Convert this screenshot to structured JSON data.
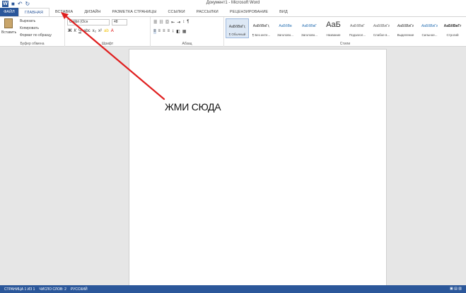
{
  "window": {
    "title": "Документ1 - Microsoft Word"
  },
  "tabs": [
    {
      "label": "ФАЙЛ"
    },
    {
      "label": "ГЛАВНАЯ"
    },
    {
      "label": "ВСТАВКА"
    },
    {
      "label": "ДИЗАЙН"
    },
    {
      "label": "РАЗМЕТКА СТРАНИЦЫ"
    },
    {
      "label": "ССЫЛКИ"
    },
    {
      "label": "РАССЫЛКИ"
    },
    {
      "label": "РЕЦЕНЗИРОВАНИЕ"
    },
    {
      "label": "ВИД"
    }
  ],
  "clipboard": {
    "paste": "Вставить",
    "cut": "Вырезать",
    "copy": "Копировать",
    "format_painter": "Формат по образцу",
    "label": "Буфер обмена"
  },
  "font": {
    "name": "Calibri (Осн",
    "size": "48",
    "label": "Шрифт"
  },
  "paragraph": {
    "label": "Абзац"
  },
  "styles": {
    "label": "Стили",
    "items": [
      {
        "preview": "АаБбВвГг,",
        "name": "¶ Обычный"
      },
      {
        "preview": "АаБбВвГг,",
        "name": "¶ Без инте..."
      },
      {
        "preview": "АаБбВв",
        "name": "Заголово..."
      },
      {
        "preview": "АаБбВвГ",
        "name": "Заголово..."
      },
      {
        "preview": "АаБ",
        "name": "Название"
      },
      {
        "preview": "АаБбВвГ",
        "name": "Подзагол..."
      },
      {
        "preview": "АаБбВвГг",
        "name": "Слабое в..."
      },
      {
        "preview": "АаБбВвГг",
        "name": "Выделение"
      },
      {
        "preview": "АаБбВвГг",
        "name": "Сильное..."
      },
      {
        "preview": "АаБбВвГг",
        "name": "Строгий"
      }
    ]
  },
  "document": {
    "text": "ЖМИ СЮДА"
  },
  "statusbar": {
    "page": "СТРАНИЦА 1 ИЗ 1",
    "words": "ЧИСЛО СЛОВ: 2",
    "language": "РУССКИЙ"
  },
  "colors": {
    "brand": "#2b579a",
    "arrow": "#e02020"
  }
}
